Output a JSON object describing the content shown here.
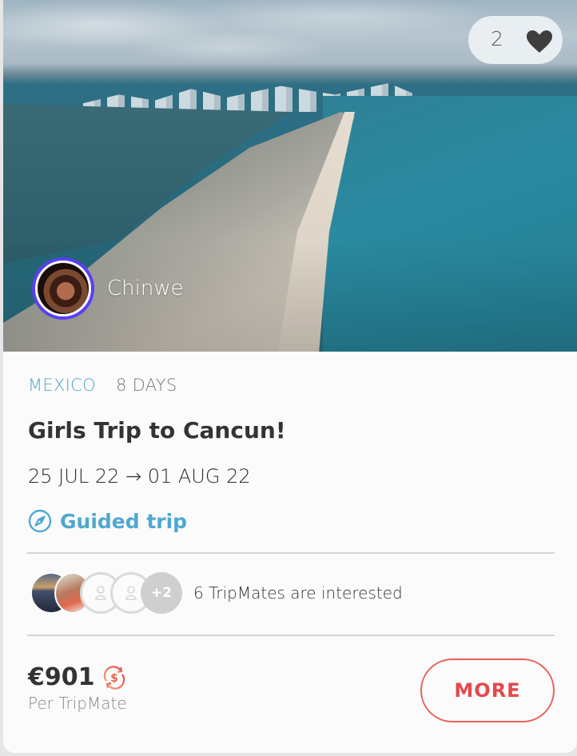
{
  "hero": {
    "image_alt": "Aerial view of Cancun hotel zone beach",
    "likes": {
      "count": "2",
      "icon": "heart-icon"
    },
    "host": {
      "name": "Chinwe",
      "avatar": "host-avatar"
    }
  },
  "trip": {
    "country": "MEXICO",
    "duration": "8 DAYS",
    "title": "Girls Trip to Cancun!",
    "dates": "25 JUL 22 → 01 AUG 22",
    "type_label": "Guided trip",
    "type_icon": "compass-icon"
  },
  "tripmates": {
    "extra_count": "+2",
    "summary": "6 TripMates are interested"
  },
  "pricing": {
    "price": "€901",
    "per_label": "Per TripMate",
    "currency_icon": "currency-exchange-icon"
  },
  "actions": {
    "more_label": "MORE"
  },
  "colors": {
    "accent_blue": "#4ea8d1",
    "accent_red": "#e5484d",
    "host_ring": "#5a3ff2"
  }
}
